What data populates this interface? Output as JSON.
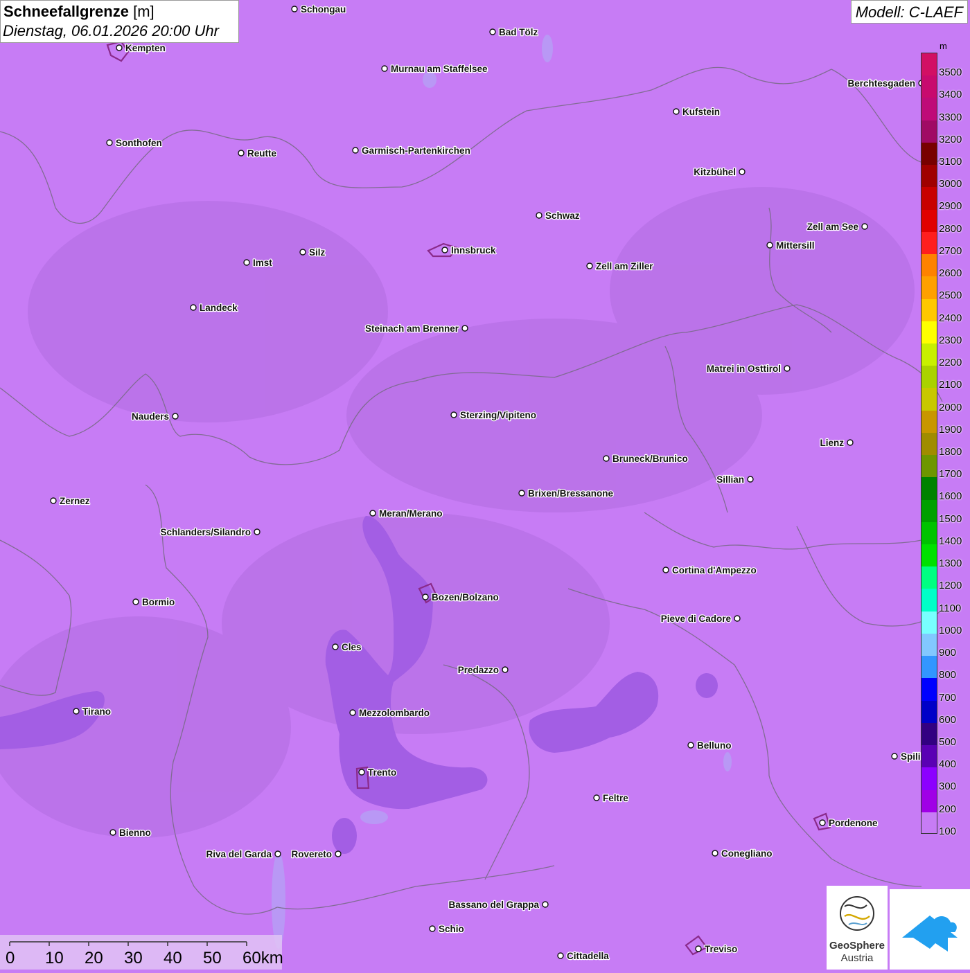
{
  "title": {
    "label": "Schneefallgrenze",
    "unit": "[m]",
    "datetime": "Dienstag, 06.01.2026 20:00 Uhr"
  },
  "model": "Modell: C-LAEF",
  "colors": {
    "background_100m": "#c77cf5",
    "band_200m": "#a35ee4",
    "boundary": "#7a6a8a",
    "lakes": "#b59ff5",
    "urban": "#8a2a8a"
  },
  "legend": {
    "unit": "m",
    "labels": [
      "3500",
      "3400",
      "3300",
      "3200",
      "3100",
      "3000",
      "2900",
      "2800",
      "2700",
      "2600",
      "2500",
      "2400",
      "2300",
      "2200",
      "2100",
      "2000",
      "1900",
      "1800",
      "1700",
      "1600",
      "1500",
      "1400",
      "1300",
      "1200",
      "1100",
      "1000",
      "900",
      "800",
      "700",
      "600",
      "500",
      "400",
      "300",
      "200",
      "100"
    ],
    "colors": [
      "#d20f64",
      "#c80a6e",
      "#bf0a78",
      "#a00a64",
      "#780000",
      "#a00000",
      "#c80000",
      "#e10000",
      "#ff1e1e",
      "#ff8200",
      "#ffa000",
      "#ffc800",
      "#ffff00",
      "#c8f000",
      "#aad200",
      "#c8c800",
      "#c89600",
      "#a08c00",
      "#6e9600",
      "#008200",
      "#00a000",
      "#00c300",
      "#00e100",
      "#00ff82",
      "#00ffc8",
      "#78ffff",
      "#82c8ff",
      "#3296ff",
      "#0000ff",
      "#0000c8",
      "#320082",
      "#5a00b4",
      "#8c00ff",
      "#a000e6",
      "#c77cf5"
    ]
  },
  "scale_bar": {
    "labels": [
      "0",
      "10",
      "20",
      "30",
      "40",
      "50",
      "60km"
    ]
  },
  "cities": [
    {
      "name": "Schongau"
    },
    {
      "name": "Bad Tölz"
    },
    {
      "name": "Kempten"
    },
    {
      "name": "Murnau am Staffelsee"
    },
    {
      "name": "Berchtesgaden"
    },
    {
      "name": "Kufstein"
    },
    {
      "name": "Sonthofen"
    },
    {
      "name": "Reutte"
    },
    {
      "name": "Garmisch-Partenkirchen"
    },
    {
      "name": "Kitzbühel"
    },
    {
      "name": "Schwaz"
    },
    {
      "name": "Zell am See"
    },
    {
      "name": "Mittersill"
    },
    {
      "name": "Innsbruck"
    },
    {
      "name": "Silz"
    },
    {
      "name": "Imst"
    },
    {
      "name": "Zell am Ziller"
    },
    {
      "name": "Landeck"
    },
    {
      "name": "Steinach am Brenner"
    },
    {
      "name": "Matrei in Osttirol"
    },
    {
      "name": "Nauders"
    },
    {
      "name": "Sterzing/Vipiteno"
    },
    {
      "name": "Lienz"
    },
    {
      "name": "Bruneck/Brunico"
    },
    {
      "name": "Sillian"
    },
    {
      "name": "Zernez"
    },
    {
      "name": "Brixen/Bressanone"
    },
    {
      "name": "Meran/Merano"
    },
    {
      "name": "Schlanders/Silandro"
    },
    {
      "name": "Cortina d'Ampezzo"
    },
    {
      "name": "Bozen/Bolzano"
    },
    {
      "name": "Bormio"
    },
    {
      "name": "Pieve di Cadore"
    },
    {
      "name": "Cles"
    },
    {
      "name": "Predazzo"
    },
    {
      "name": "Tirano"
    },
    {
      "name": "Mezzolombardo"
    },
    {
      "name": "Belluno"
    },
    {
      "name": "Spili"
    },
    {
      "name": "Trento"
    },
    {
      "name": "Feltre"
    },
    {
      "name": "Pordenone"
    },
    {
      "name": "Bienno"
    },
    {
      "name": "Riva del Garda"
    },
    {
      "name": "Rovereto"
    },
    {
      "name": "Conegliano"
    },
    {
      "name": "Bassano del Grappa"
    },
    {
      "name": "Schio"
    },
    {
      "name": "Treviso"
    },
    {
      "name": "Cittadella"
    }
  ],
  "logos": {
    "geosphere_line1": "GeoSphere",
    "geosphere_line2": "Austria"
  }
}
